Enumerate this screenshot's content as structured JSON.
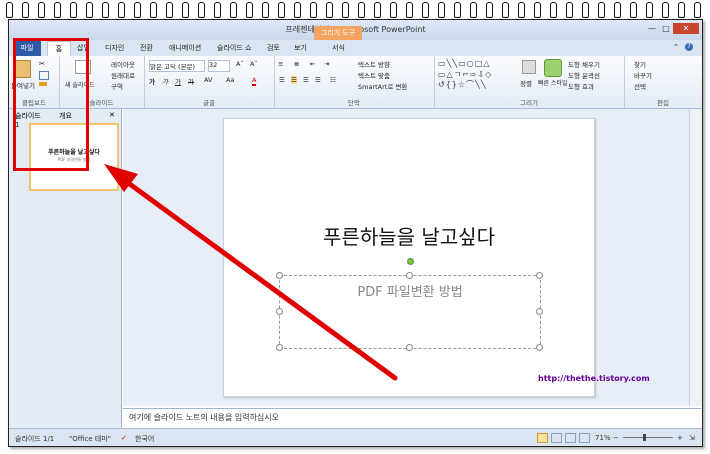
{
  "window": {
    "title": "프레젠테이션1 - Microsoft PowerPoint",
    "context_tab": "그리기 도구"
  },
  "tabs": {
    "file": "파일",
    "home": "홈",
    "insert": "삽입",
    "design": "디자인",
    "transitions": "전환",
    "animations": "애니메이션",
    "slideshow": "슬라이드 쇼",
    "review": "검토",
    "view": "보기",
    "format": "서식"
  },
  "ribbon": {
    "clipboard": {
      "label": "클립보드",
      "paste": "붙여넣기"
    },
    "slides": {
      "label": "슬라이드",
      "new_slide": "새 슬라이드",
      "layout": "레이아웃",
      "reset": "원래대로",
      "section": "구역"
    },
    "font": {
      "label": "글꼴",
      "font_name": "맑은 고딕 (본문)",
      "font_size": "32"
    },
    "paragraph": {
      "label": "단락",
      "text_direction": "텍스트 방향",
      "align_text": "텍스트 맞춤",
      "smartart": "SmartArt로 변환"
    },
    "drawing": {
      "label": "그리기",
      "arrange": "정렬",
      "quick_styles": "빠른 스타일",
      "fill": "도형 채우기",
      "outline": "도형 윤곽선",
      "effects": "도형 효과"
    },
    "editing": {
      "label": "편집",
      "find": "찾기",
      "replace": "바꾸기",
      "select": "선택"
    }
  },
  "panel": {
    "tab_slides": "슬라이드",
    "tab_outline": "개요",
    "slide_number": "1",
    "thumb_title": "푸른하늘을 날고싶다",
    "thumb_subtitle": "PDF 파일변환 방법"
  },
  "slide": {
    "title": "푸른하늘을 날고싶다",
    "subtitle": "PDF 파일변환 방법",
    "url": "http://thethe.tistory.com"
  },
  "notes": {
    "placeholder": "여기에 슬라이드 노트의 내용을 입력하십시오"
  },
  "status": {
    "slide": "슬라이드 1/1",
    "theme": "\"Office 테마\"",
    "language": "한국어",
    "zoom": "71%"
  },
  "colors": {
    "annotation_red": "#e00000",
    "file_tab": "#2f5aa8",
    "context_tab": "#f4a460"
  }
}
